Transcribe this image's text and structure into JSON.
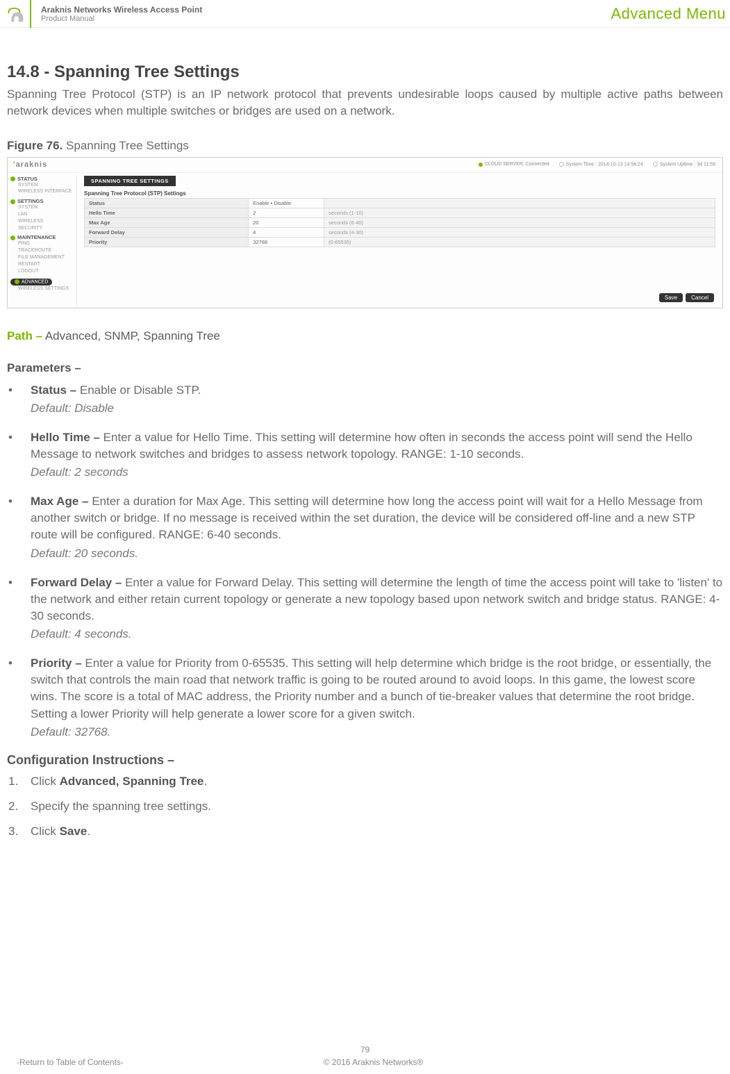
{
  "header": {
    "title": "Araknis Networks Wireless Access Point",
    "subtitle": "Product Manual",
    "menu_label": "Advanced Menu"
  },
  "section": {
    "heading": "14.8 - Spanning Tree Settings",
    "intro": "Spanning Tree Protocol (STP) is an IP network protocol that prevents undesirable loops caused by multiple active paths between network devices when multiple switches or bridges are used on a network."
  },
  "figure": {
    "label": "Figure 76.",
    "caption": "Spanning Tree Settings"
  },
  "screenshot": {
    "logo": "araknis",
    "cloud_status": "CLOUD SERVER: Connected",
    "sys_time": "System Time : 2014-10-13 14:56:24",
    "sys_uptime": "System Uptime : 3d 11:59",
    "sidebar": {
      "status": {
        "head": "STATUS",
        "items": [
          "SYSTEM",
          "WIRELESS INTERFACE"
        ]
      },
      "settings": {
        "head": "SETTINGS",
        "items": [
          "SYSTEM",
          "LAN",
          "WIRELESS",
          "SECURITY"
        ]
      },
      "maintenance": {
        "head": "MAINTENANCE",
        "items": [
          "PING",
          "TRACEROUTE",
          "FILE MANAGEMENT",
          "RESTART",
          "LOGOUT"
        ]
      },
      "advanced": {
        "head": "ADVANCED",
        "items": [
          "WIRELESS SETTINGS"
        ]
      }
    },
    "tab": "SPANNING TREE SETTINGS",
    "panel_title": "Spanning Tree Protocol (STP) Settings",
    "rows": [
      {
        "name": "Status",
        "value": "Enable  •  Disable",
        "hint": ""
      },
      {
        "name": "Hello Time",
        "value": "2",
        "hint": "seconds (1-10)"
      },
      {
        "name": "Max Age",
        "value": "20",
        "hint": "seconds (6-40)"
      },
      {
        "name": "Forward Delay",
        "value": "4",
        "hint": "seconds (4-30)"
      },
      {
        "name": "Priority",
        "value": "32768",
        "hint": "(0-65535)"
      }
    ],
    "save": "Save",
    "cancel": "Cancel"
  },
  "path": {
    "label": "Path –",
    "value": " Advanced, SNMP, Spanning Tree"
  },
  "params_heading": "Parameters –",
  "params": [
    {
      "name": "Status – ",
      "desc": "Enable or Disable STP.",
      "default": "Default: Disable"
    },
    {
      "name": "Hello Time – ",
      "desc": "Enter a value for Hello Time. This setting will determine how often in seconds the access point will send the Hello Message to network switches and bridges to assess network topology. RANGE: 1-10 seconds.",
      "default": "Default: 2 seconds"
    },
    {
      "name": "Max Age – ",
      "desc": "Enter a duration for Max Age. This setting will determine how long the access point will wait for a Hello Message from another switch or bridge. If no message is received within the set duration, the device will be considered off-line and a new STP route will be configured. RANGE: 6-40 seconds.",
      "default": "Default: 20 seconds."
    },
    {
      "name": "Forward Delay – ",
      "desc": "Enter a value for Forward Delay. This setting will determine the length of time the access point will take to 'listen' to the network and either retain current topology or generate a new topology based upon network switch and bridge status. RANGE: 4-30 seconds.",
      "default": "Default: 4 seconds."
    },
    {
      "name": "Priority – ",
      "desc": "Enter a value for Priority from 0-65535. This setting will help determine which bridge is the root bridge, or essentially, the switch that controls the main road that network traffic is going to be routed around to avoid loops. In this game, the lowest score wins. The score is a total of MAC address, the Priority number and a bunch of tie-breaker values that determine the root bridge. Setting a lower Priority will help generate a lower score for a given switch.",
      "default": "Default: 32768."
    }
  ],
  "config_heading": "Configuration Instructions –",
  "config_steps": [
    {
      "pre": "Click ",
      "bold": "Advanced, Spanning Tree",
      "post": "."
    },
    {
      "pre": "Specify the spanning tree settings.",
      "bold": "",
      "post": ""
    },
    {
      "pre": "Click ",
      "bold": "Save",
      "post": "."
    }
  ],
  "footer": {
    "page": "79",
    "toc": "-Return to Table of Contents-",
    "copyright": "© 2016 Araknis Networks®"
  }
}
